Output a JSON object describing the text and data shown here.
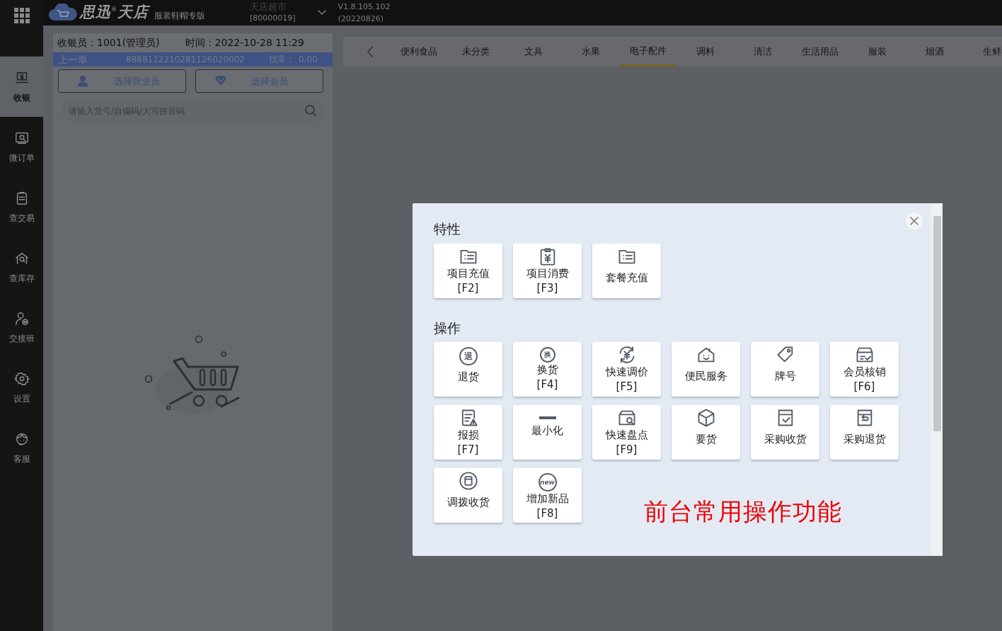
{
  "top_bar": {
    "logo_name": "思迅",
    "logo_mark": "®",
    "logo_name2": "天店",
    "edition": "服装鞋帽专版",
    "store_name": "天店超市",
    "store_code": "[80000019]",
    "version": "V1.8.105.102",
    "build": "(20220826)"
  },
  "sidebar": {
    "items": [
      {
        "label": "收银",
        "selected": true
      },
      {
        "label": "微订单",
        "selected": false
      },
      {
        "label": "查交易",
        "selected": false
      },
      {
        "label": "查库存",
        "selected": false
      },
      {
        "label": "交接班",
        "selected": false
      },
      {
        "label": "设置",
        "selected": false
      },
      {
        "label": "客服",
        "selected": false
      }
    ]
  },
  "cashier": {
    "cashier": "收银员：1001(管理员)",
    "time": "时间：2022-10-28 11:29",
    "last_order_label": "上一单",
    "last_order_no": "8888112210281126020002",
    "change_label": "找零：",
    "change": "0.00",
    "buttons": [
      "选择营业员",
      "选择会员"
    ],
    "search": {
      "placeholder": "请输入货号/自编码/大写拼音码"
    }
  },
  "categories": [
    {
      "label": "便利食品",
      "selected": false
    },
    {
      "label": "未分类",
      "selected": false
    },
    {
      "label": "文具",
      "selected": false
    },
    {
      "label": "水果",
      "selected": false
    },
    {
      "label": "电子配件",
      "selected": true
    },
    {
      "label": "调料",
      "selected": false
    },
    {
      "label": "清洁",
      "selected": false
    },
    {
      "label": "生活用品",
      "selected": false
    },
    {
      "label": "服装",
      "selected": false
    },
    {
      "label": "烟酒",
      "selected": false
    },
    {
      "label": "生鲜",
      "selected": false
    }
  ],
  "dialog": {
    "sections": [
      {
        "title": "特性",
        "items": [
          {
            "label": "项目充值",
            "shortcut": "[F2]"
          },
          {
            "label": "项目消费",
            "shortcut": "[F3]"
          },
          {
            "label": "套餐充值"
          }
        ]
      },
      {
        "title": "操作",
        "items": [
          {
            "label": "退货",
            "icon_text": "退"
          },
          {
            "label": "换货",
            "shortcut": "[F4]",
            "icon_text": "换"
          },
          {
            "label": "快速调价",
            "shortcut": "[F5]"
          },
          {
            "label": "便民服务"
          },
          {
            "label": "牌号"
          },
          {
            "label": "会员核销",
            "shortcut": "[F6]"
          },
          {
            "label": "报损",
            "shortcut": "[F7]"
          },
          {
            "label": "最小化"
          },
          {
            "label": "快速盘点",
            "shortcut": "[F9]"
          },
          {
            "label": "要货"
          },
          {
            "label": "采购收货"
          },
          {
            "label": "采购退货"
          },
          {
            "label": "调拨收货"
          },
          {
            "label": "增加新品",
            "shortcut": "[F8]",
            "icon_text": "new"
          }
        ]
      }
    ],
    "note": "前台常用操作功能"
  }
}
